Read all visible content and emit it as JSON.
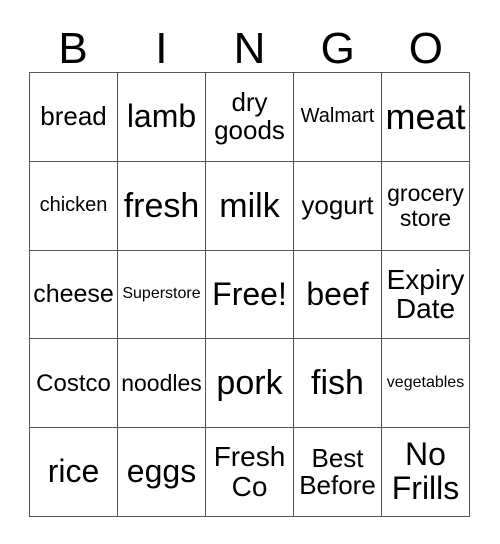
{
  "card": {
    "title": "BINGO",
    "header_letters": [
      "B",
      "I",
      "N",
      "G",
      "O"
    ],
    "grid_size": "5x5",
    "colors": {
      "background": "#ffffff",
      "text": "#000000",
      "grid_line": "#555555"
    },
    "free_space": "Free!",
    "cells": [
      [
        {
          "text": "bread",
          "size": 26
        },
        {
          "text": "lamb",
          "size": 32
        },
        {
          "text": "dry\ngoods",
          "size": 26
        },
        {
          "text": "Walmart",
          "size": 20
        },
        {
          "text": "meat",
          "size": 36
        }
      ],
      [
        {
          "text": "chicken",
          "size": 20
        },
        {
          "text": "fresh",
          "size": 34
        },
        {
          "text": "milk",
          "size": 34
        },
        {
          "text": "yogurt",
          "size": 26
        },
        {
          "text": "grocery\nstore",
          "size": 23
        }
      ],
      [
        {
          "text": "cheese",
          "size": 25
        },
        {
          "text": "Superstore",
          "size": 16
        },
        {
          "text": "Free!",
          "size": 32
        },
        {
          "text": "beef",
          "size": 32
        },
        {
          "text": "Expiry\nDate",
          "size": 28
        }
      ],
      [
        {
          "text": "Costco",
          "size": 24
        },
        {
          "text": "noodles",
          "size": 23
        },
        {
          "text": "pork",
          "size": 34
        },
        {
          "text": "fish",
          "size": 34
        },
        {
          "text": "vegetables",
          "size": 16
        }
      ],
      [
        {
          "text": "rice",
          "size": 32
        },
        {
          "text": "eggs",
          "size": 32
        },
        {
          "text": "Fresh\nCo",
          "size": 28
        },
        {
          "text": "Best\nBefore",
          "size": 26
        },
        {
          "text": "No\nFrills",
          "size": 32
        }
      ]
    ]
  }
}
